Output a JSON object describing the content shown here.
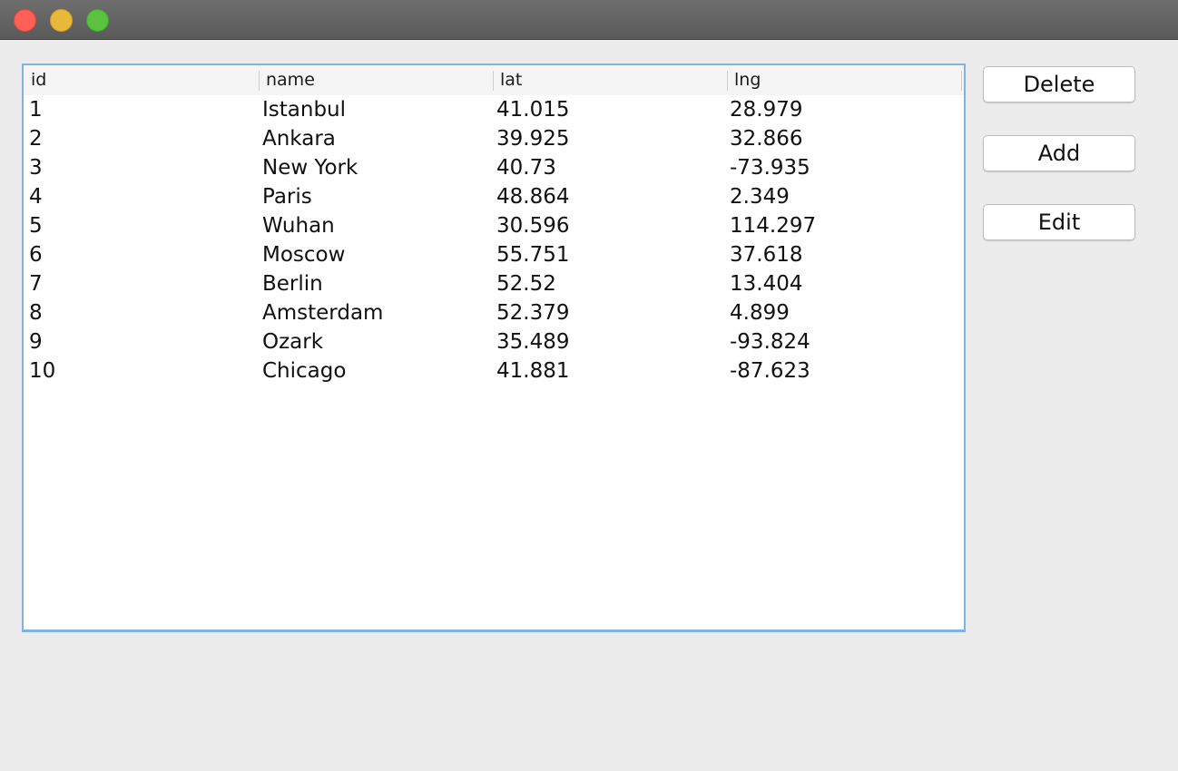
{
  "window": {
    "traffic_lights": {
      "close": "#fe5f57",
      "minimize": "#e8b93b",
      "zoom": "#5ac23f"
    }
  },
  "table": {
    "columns": [
      "id",
      "name",
      "lat",
      "lng"
    ],
    "rows": [
      [
        "1",
        "Istanbul",
        "41.015",
        "28.979"
      ],
      [
        "2",
        "Ankara",
        "39.925",
        "32.866"
      ],
      [
        "3",
        "New York",
        "40.73",
        "-73.935"
      ],
      [
        "4",
        "Paris",
        "48.864",
        "2.349"
      ],
      [
        "5",
        "Wuhan",
        "30.596",
        "114.297"
      ],
      [
        "6",
        "Moscow",
        "55.751",
        "37.618"
      ],
      [
        "7",
        "Berlin",
        "52.52",
        "13.404"
      ],
      [
        "8",
        "Amsterdam",
        "52.379",
        "4.899"
      ],
      [
        "9",
        "Ozark",
        "35.489",
        "-93.824"
      ],
      [
        "10",
        "Chicago",
        "41.881",
        "-87.623"
      ]
    ]
  },
  "buttons": {
    "delete_label": "Delete",
    "add_label": "Add",
    "edit_label": "Edit"
  },
  "colors": {
    "focus_border": "#7fb3e6",
    "window_background": "#ececec"
  }
}
